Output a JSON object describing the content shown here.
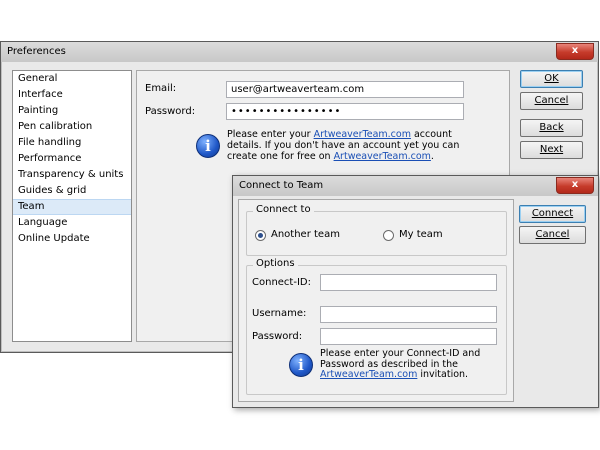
{
  "preferences": {
    "title": "Preferences",
    "close_glyph": "x",
    "categories": [
      "General",
      "Interface",
      "Painting",
      "Pen calibration",
      "File handling",
      "Performance",
      "Transparency & units",
      "Guides & grid",
      "Team",
      "Language",
      "Online Update"
    ],
    "selected_category": "Team",
    "email_label": "Email:",
    "email_value": "user@artweaverteam.com",
    "password_label": "Password:",
    "password_value": "••••••••••••••••",
    "info_text_1": "Please enter your ",
    "info_link_1": "ArtweaverTeam.com",
    "info_text_2": " account details. If you don't have an account yet you can create one for free on ",
    "info_link_2": "ArtweaverTeam.com",
    "info_text_3": ".",
    "buttons": {
      "ok": "OK",
      "cancel": "Cancel",
      "back": "Back",
      "next": "Next"
    }
  },
  "connect_dialog": {
    "title": "Connect to Team",
    "close_glyph": "x",
    "connect_to_legend": "Connect to",
    "radio_another_team": "Another team",
    "radio_my_team": "My team",
    "selected_radio": "another_team",
    "options_legend": "Options",
    "connect_id_label": "Connect-ID:",
    "connect_id_value": "",
    "username_label": "Username:",
    "username_value": "",
    "password_label": "Password:",
    "password_value": "",
    "info_text_1": "Please enter your Connect-ID and Password as described in the ",
    "info_link": "ArtweaverTeam.com",
    "info_text_2": " invitation.",
    "buttons": {
      "connect": "Connect",
      "cancel": "Cancel"
    }
  },
  "colors": {
    "accent": "#1a4fb5",
    "close_button": "#c63b2b",
    "selection": "#dceaf8"
  }
}
